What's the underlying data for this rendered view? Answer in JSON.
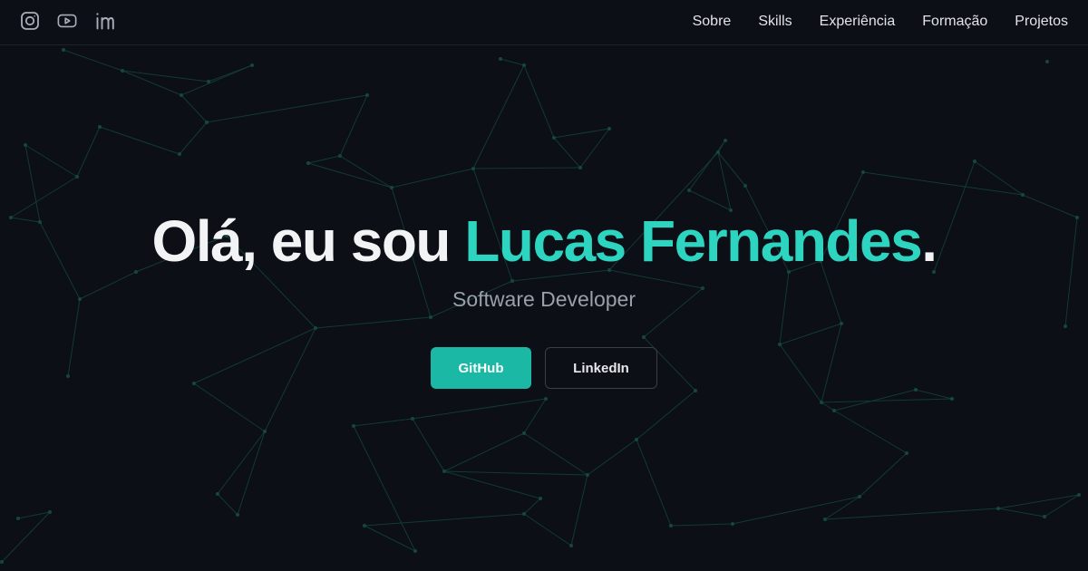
{
  "colors": {
    "background": "#0c0f16",
    "accent": "#2dd4bf",
    "button_primary": "#1bb8a5",
    "network_line": "#123a34"
  },
  "social": [
    {
      "icon": "instagram-icon"
    },
    {
      "icon": "youtube-icon"
    },
    {
      "icon": "linkedin-icon"
    }
  ],
  "nav": {
    "items": [
      "Sobre",
      "Skills",
      "Experiência",
      "Formação",
      "Projetos"
    ]
  },
  "hero": {
    "greeting": "Olá, eu sou ",
    "name": "Lucas Fernandes",
    "period": ".",
    "subtitle": "Software Developer",
    "buttons": {
      "github": "GitHub",
      "linkedin": "LinkedIn"
    }
  }
}
